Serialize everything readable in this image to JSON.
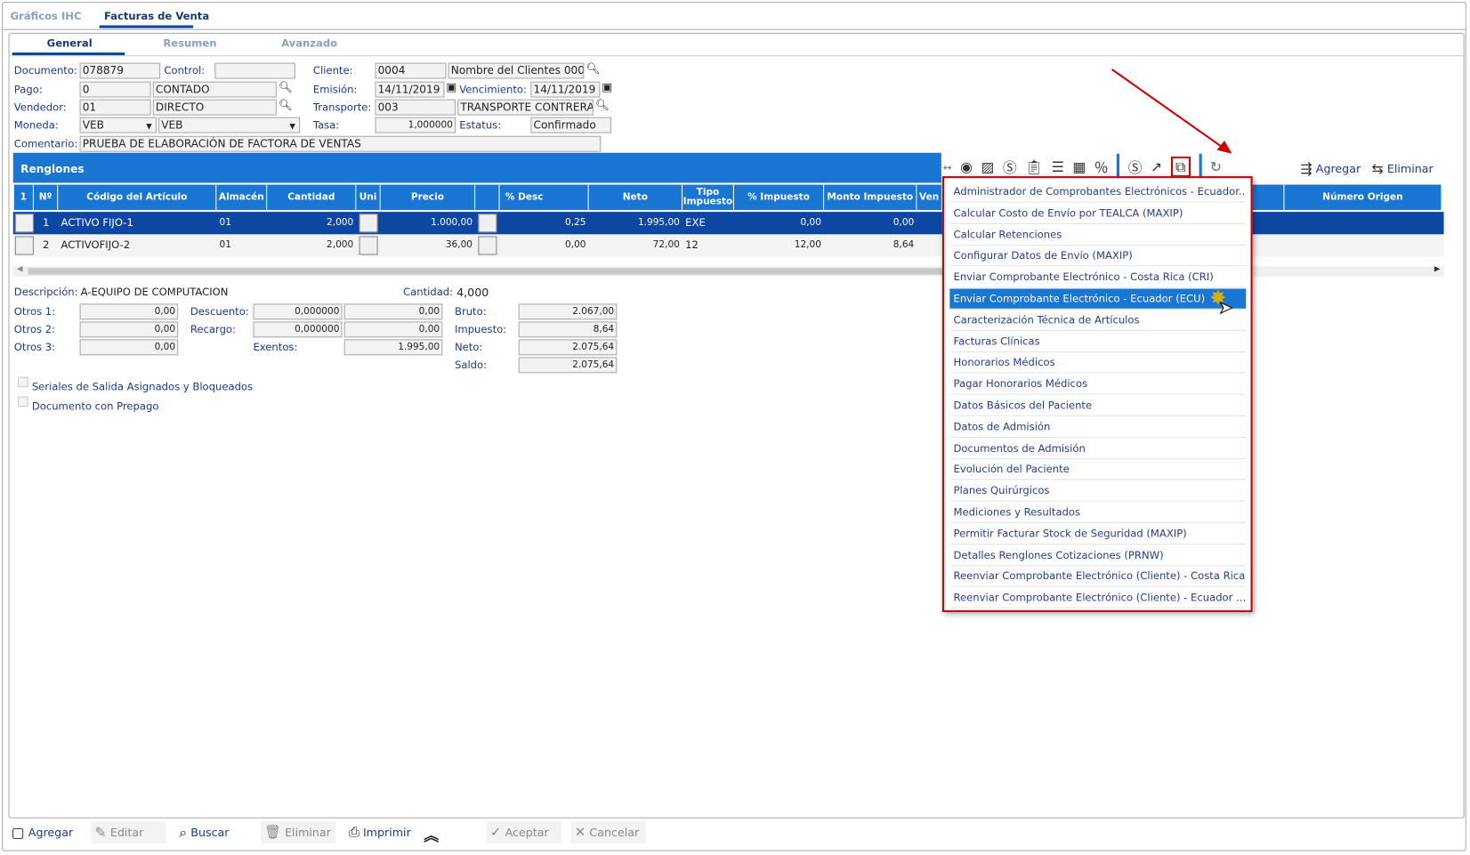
{
  "tabs": [
    {
      "label": "Gráficos IHC"
    },
    {
      "label": "Facturas de Venta"
    }
  ],
  "subtabs": [
    {
      "label": "General"
    },
    {
      "label": "Resumen"
    },
    {
      "label": "Avanzado"
    }
  ],
  "form": {
    "documento_label": "Documento:",
    "documento": "078879",
    "control_label": "Control:",
    "control": "",
    "cliente_label": "Cliente:",
    "cliente_code": "0004",
    "cliente_name": "Nombre del Clientes 000",
    "pago_label": "Pago:",
    "pago_code": "0",
    "pago_name": "CONTADO",
    "emision_label": "Emisión:",
    "emision": "14/11/2019",
    "vencimiento_label": "Vencimiento:",
    "vencimiento": "14/11/2019",
    "vendedor_label": "Vendedor:",
    "vendedor_code": "01",
    "vendedor_name": "DIRECTO",
    "transporte_label": "Transporte:",
    "transporte_code": "003",
    "transporte_name": "TRANSPORTE CONTRERA",
    "moneda_label": "Moneda:",
    "moneda1": "VEB",
    "moneda2": "VEB",
    "tasa_label": "Tasa:",
    "tasa": "1,000000",
    "estatus_label": "Estatus:",
    "estatus": "Confirmado",
    "comentario_label": "Comentario:",
    "comentario": "PRUEBA DE ELABORACIÓN DE FACTORA DE VENTAS"
  },
  "grid": {
    "title": "Renglones",
    "add_label": "Agregar",
    "delete_label": "Eliminar",
    "columns": [
      "1",
      "Nº",
      "Código del Artículo",
      "Almacén",
      "Cantidad",
      "Uni",
      "Precio",
      "",
      "% Desc",
      "Neto",
      "Tipo Impuesto",
      "% Impuesto",
      "Monto Impuesto",
      "Ven",
      "Número Origen"
    ],
    "rows": [
      {
        "n": "1",
        "codigo": "ACTIVO FIJO-1",
        "almacen": "01",
        "cantidad": "2,000",
        "precio": "1.000,00",
        "desc": "0,25",
        "neto": "1.995,00",
        "tipo": "EXE",
        "pimp": "0,00",
        "monto": "0,00",
        "selected": true
      },
      {
        "n": "2",
        "codigo": "ACTIVOFIJO-2",
        "almacen": "01",
        "cantidad": "2,000",
        "precio": "36,00",
        "desc": "0,00",
        "neto": "72,00",
        "tipo": "12",
        "pimp": "12,00",
        "monto": "8,64",
        "selected": false
      }
    ]
  },
  "toolbar_icons": [
    "expand-icon",
    "user-circle-icon",
    "image-icon",
    "dollar-icon",
    "clipboard-check-icon",
    "list-icon",
    "boxes-icon",
    "percent-icon",
    "dollar-icon",
    "external-link-icon",
    "puzzle-icon",
    "refresh-icon"
  ],
  "menu": {
    "items": [
      "Administrador de Comprobantes Electrónicos - Ecuador...",
      "Calcular Costo de Envío por TEALCA (MAXIP)",
      "Calcular Retenciones",
      "Configurar Datos de Envío (MAXIP)",
      "Enviar Comprobante Electrónico - Costa Rica (CRI)",
      "Enviar Comprobante Electrónico - Ecuador (ECU)",
      "Caracterización Técnica de Artículos",
      "Facturas Clínicas",
      "Honorarios Médicos",
      "Pagar Honorarios Médicos",
      "Datos Básicos del Paciente",
      "Datos de Admisión",
      "Documentos de Admisión",
      "Evolución del Paciente",
      "Planes Quirúrgicos",
      "Mediciones y Resultados",
      "Permitir Facturar Stock de Seguridad (MAXIP)",
      "Detalles Renglones Cotizaciones (PRNW)",
      "Reenviar Comprobante Electrónico (Cliente) - Costa Rica",
      "Reenviar Comprobante Electrónico (Cliente) - Ecuador ..."
    ],
    "highlighted_index": 5
  },
  "summary": {
    "descripcion_label": "Descripción:",
    "descripcion": "A-EQUIPO DE COMPUTACION",
    "cantidad_label": "Cantidad:",
    "cantidad": "4,000",
    "otros1_label": "Otros 1:",
    "otros1": "0,00",
    "otros2_label": "Otros 2:",
    "otros2": "0,00",
    "otros3_label": "Otros 3:",
    "otros3": "0,00",
    "descuento_label": "Descuento:",
    "descuento_pct": "0,000000",
    "descuento": "0,00",
    "recargo_label": "Recargo:",
    "recargo_pct": "0,000000",
    "recargo": "0,00",
    "exentos_label": "Exentos:",
    "exentos": "1.995,00",
    "bruto_label": "Bruto:",
    "bruto": "2.067,00",
    "impuesto_label": "Impuesto:",
    "impuesto": "8,64",
    "neto_label": "Neto:",
    "neto": "2.075,64",
    "saldo_label": "Saldo:",
    "saldo": "2.075,64",
    "check1": "Seriales de Salida Asignados y Bloqueados",
    "check2": "Documento con Prepago"
  },
  "bottom": {
    "agregar": "Agregar",
    "editar": "Editar",
    "buscar": "Buscar",
    "eliminar": "Eliminar",
    "imprimir": "Imprimir",
    "aceptar": "Aceptar",
    "cancelar": "Cancelar"
  },
  "colors": {
    "primary": "#1976d2",
    "selected_row": "#0d47a1",
    "annotation": "#cc0000"
  }
}
